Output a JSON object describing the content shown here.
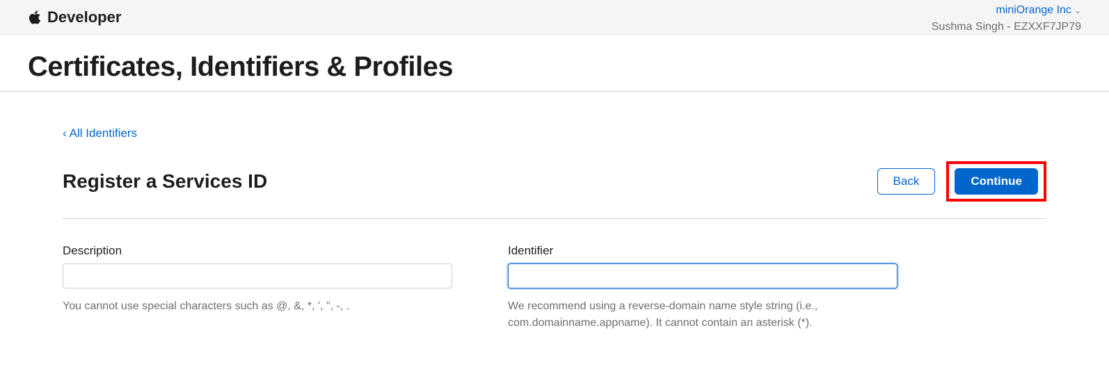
{
  "header": {
    "brand": "Developer",
    "team_name": "miniOrange Inc",
    "user_id": "Sushma Singh - EZXXF7JP79"
  },
  "page": {
    "title": "Certificates, Identifiers & Profiles"
  },
  "nav": {
    "back_link": "All Identifiers"
  },
  "subpage": {
    "title": "Register a Services ID",
    "back_button": "Back",
    "continue_button": "Continue"
  },
  "form": {
    "description": {
      "label": "Description",
      "value": "",
      "hint": "You cannot use special characters such as @, &, *, ', \", -, ."
    },
    "identifier": {
      "label": "Identifier",
      "value": "",
      "hint": "We recommend using a reverse-domain name style string (i.e., com.domainname.appname). It cannot contain an asterisk (*)."
    }
  }
}
